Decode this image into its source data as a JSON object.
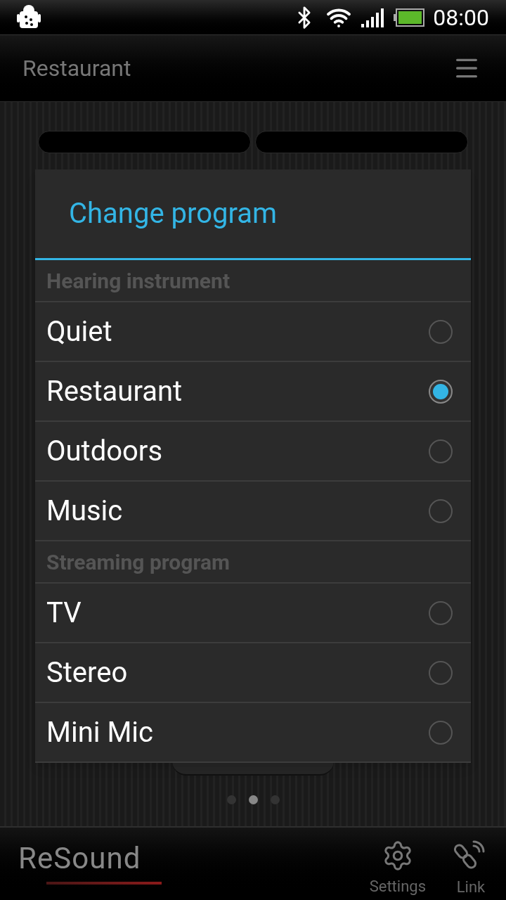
{
  "status_bar": {
    "time": "08:00"
  },
  "app_bar": {
    "title": "Restaurant"
  },
  "page_dots": [
    {
      "selected": false
    },
    {
      "selected": true
    },
    {
      "selected": false
    }
  ],
  "dialog": {
    "title": "Change program",
    "sections": [
      {
        "header": "Hearing instrument",
        "options": [
          {
            "label": "Quiet",
            "selected": false
          },
          {
            "label": "Restaurant",
            "selected": true
          },
          {
            "label": "Outdoors",
            "selected": false
          },
          {
            "label": "Music",
            "selected": false
          }
        ]
      },
      {
        "header": "Streaming program",
        "options": [
          {
            "label": "TV",
            "selected": false
          },
          {
            "label": "Stereo",
            "selected": false
          },
          {
            "label": "Mini Mic",
            "selected": false
          }
        ]
      }
    ]
  },
  "bottom_bar": {
    "logo": "ReSound",
    "items": [
      {
        "label": "Settings",
        "kind": "settings"
      },
      {
        "label": "Link",
        "kind": "link"
      }
    ]
  }
}
